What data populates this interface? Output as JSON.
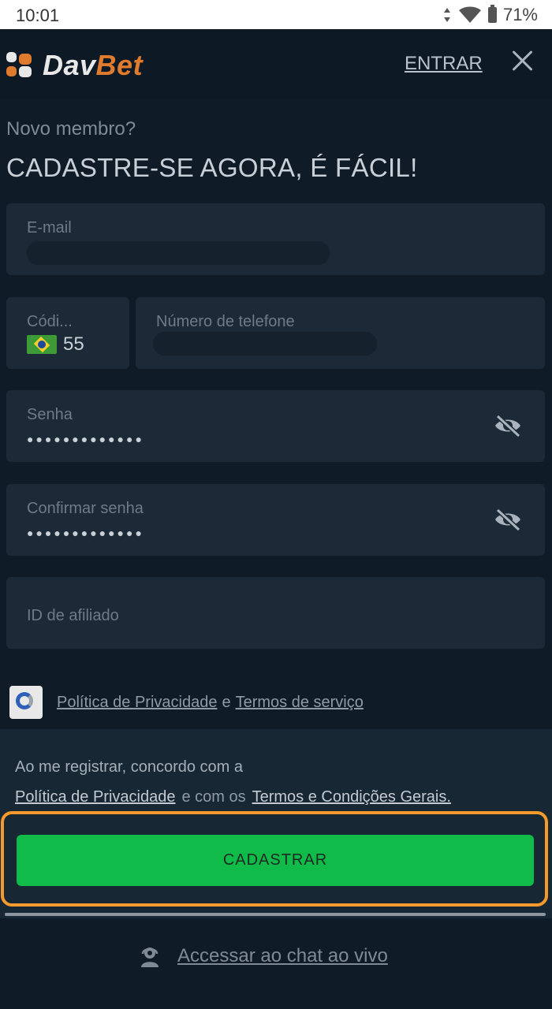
{
  "status_bar": {
    "time": "10:01",
    "battery": "71%"
  },
  "header": {
    "logo": {
      "part1": "Dav",
      "part2": "Bet"
    },
    "login_link": "ENTRAR",
    "close_icon": "close-icon"
  },
  "form": {
    "subtitle": "Novo membro?",
    "title": "CADASTRE-SE AGORA, É FÁCIL!",
    "email_label": "E-mail",
    "code_label": "Códi...",
    "code_value": "55",
    "phone_label": "Número de telefone",
    "password_label": "Senha",
    "password_value": "●●●●●●●●●●●●●",
    "confirm_label": "Confirmar senha",
    "confirm_value": "●●●●●●●●●●●●●",
    "affiliate_label": "ID de afiliado"
  },
  "captcha": {
    "privacy": "Política de Privacidade",
    "and": "e",
    "terms": "Termos de serviço"
  },
  "agreement": {
    "line1": "Ao me registrar, concordo com a",
    "privacy": "Política de Privacidade",
    "middle": "e com os",
    "terms": "Termos e Condições Gerais."
  },
  "submit_label": "CADASTRAR",
  "chat_label": "Accessar ao chat ao vivo",
  "colors": {
    "accent": "#10bb49",
    "highlight": "#f59a2c",
    "brand": "#e07a2c"
  }
}
